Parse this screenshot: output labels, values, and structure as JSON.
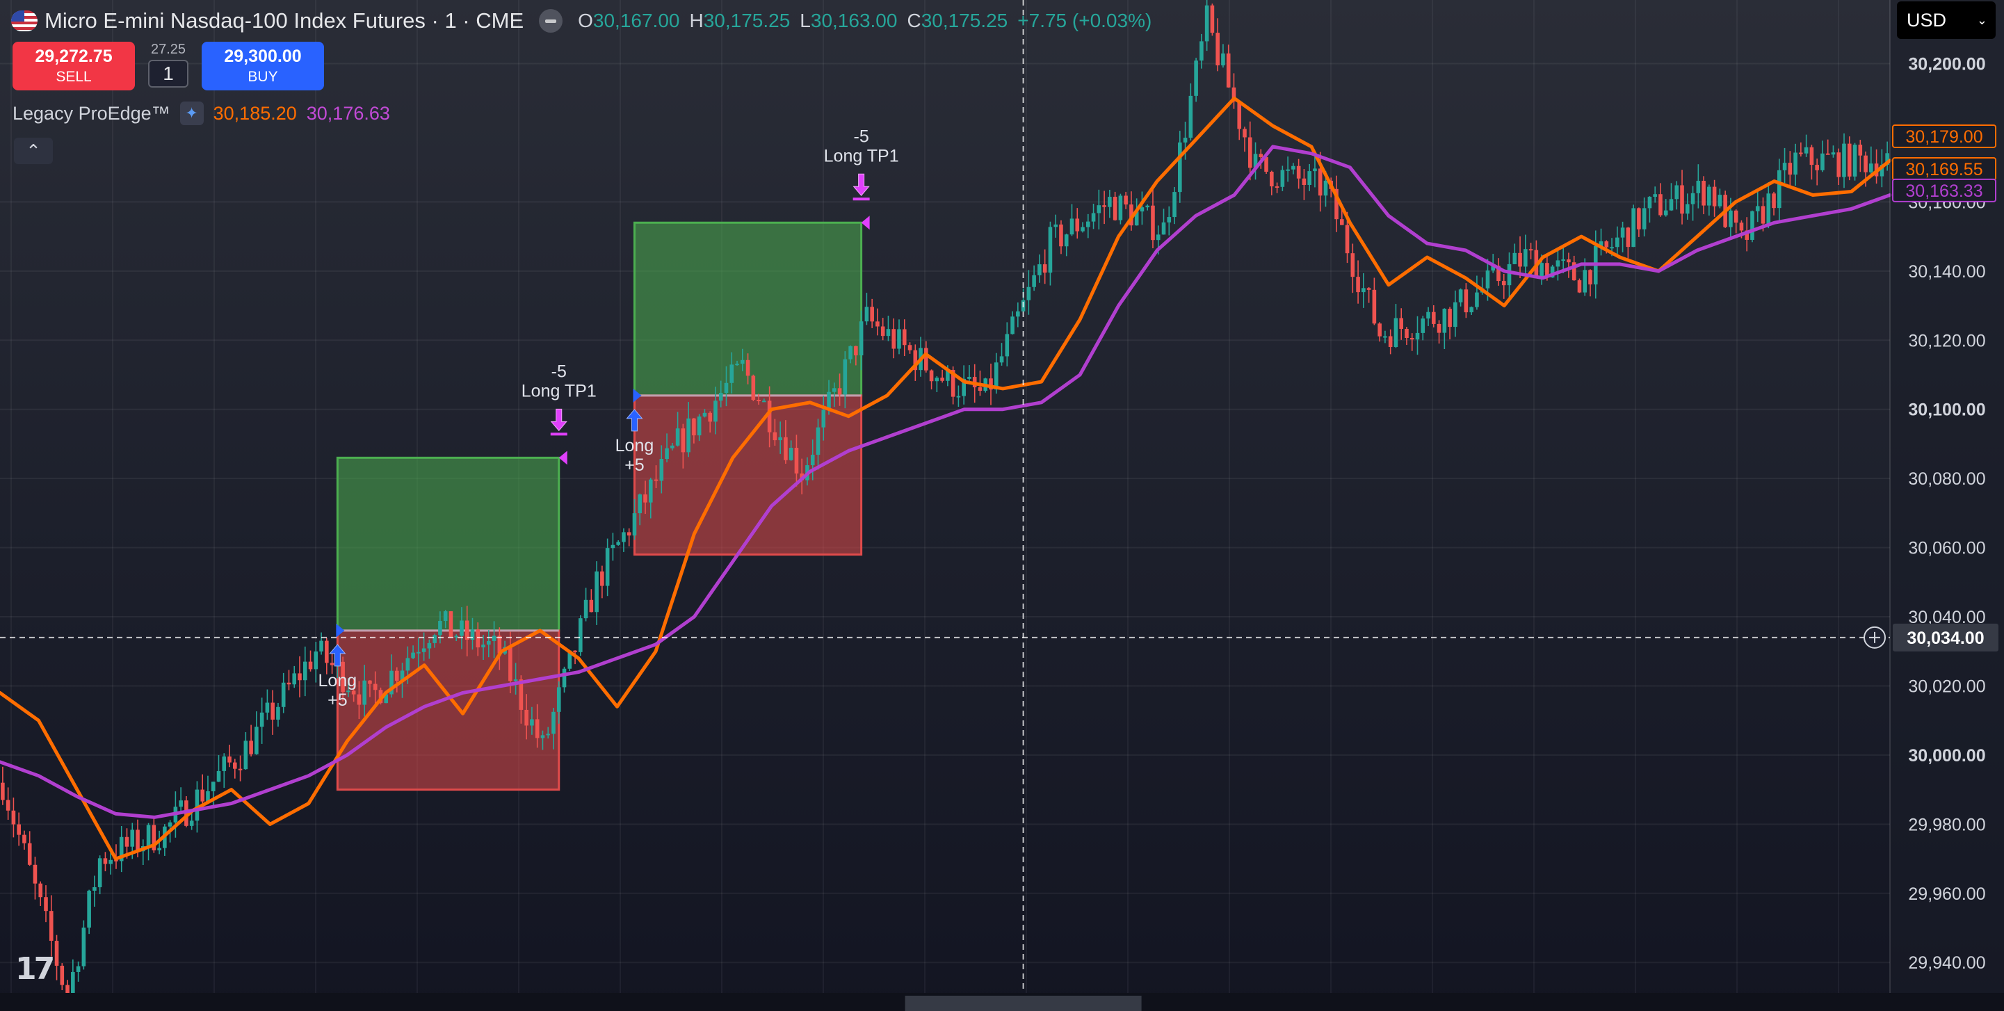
{
  "header": {
    "symbol_title": "Micro E-mini Nasdaq-100 Index Futures · 1 · CME",
    "ohlc": {
      "o_label": "O",
      "o": "30,167.00",
      "h_label": "H",
      "h": "30,175.25",
      "l_label": "L",
      "l": "30,163.00",
      "c_label": "C",
      "c": "30,175.25",
      "change": "+7.75 (+0.03%)"
    }
  },
  "order_panel": {
    "sell_price": "29,272.75",
    "sell_label": "SELL",
    "spread": "27.25",
    "quantity": "1",
    "buy_price": "29,300.00",
    "buy_label": "BUY"
  },
  "indicator": {
    "name": "Legacy ProEdge™",
    "value1": "30,185.20",
    "value2": "30,176.63"
  },
  "currency": "USD",
  "colors": {
    "up": "#26a69a",
    "down": "#ef5350",
    "fast_ma": "#ff6d00",
    "slow_ma": "#b13fcf",
    "take_profit_zone": "#4caf50",
    "stop_zone": "#e04b4b",
    "entry_arrow": "#2962ff",
    "exit_arrow": "#e040fb"
  },
  "price_axis": {
    "ticks": [
      {
        "value": 30200,
        "label": "30,200.00",
        "bold": true
      },
      {
        "value": 30160,
        "label": "30,160.00"
      },
      {
        "value": 30140,
        "label": "30,140.00"
      },
      {
        "value": 30120,
        "label": "30,120.00"
      },
      {
        "value": 30100,
        "label": "30,100.00",
        "bold": true
      },
      {
        "value": 30080,
        "label": "30,080.00"
      },
      {
        "value": 30060,
        "label": "30,060.00"
      },
      {
        "value": 30040,
        "label": "30,040.00"
      },
      {
        "value": 30020,
        "label": "30,020.00"
      },
      {
        "value": 30000,
        "label": "30,000.00",
        "bold": true
      },
      {
        "value": 29980,
        "label": "29,980.00"
      },
      {
        "value": 29960,
        "label": "29,960.00"
      },
      {
        "value": 29940,
        "label": "29,940.00"
      }
    ],
    "badges": [
      {
        "value": 30179.0,
        "label": "30,179.00",
        "color": "#ff6d00"
      },
      {
        "value": 30169.55,
        "label": "30,169.55",
        "color": "#ff6d00"
      },
      {
        "value": 30163.33,
        "label": "30,163.33",
        "color": "#b13fcf"
      }
    ],
    "crosshair": {
      "value": 30034.0,
      "label": "30,034.00"
    }
  },
  "chart_data": {
    "type": "candlestick",
    "y_range": [
      29932,
      30216
    ],
    "bar_count": 350,
    "x_range_bars": [
      0,
      350
    ],
    "segments": [
      {
        "bar": 0,
        "price": 29992
      },
      {
        "bar": 12,
        "price": 29930
      },
      {
        "bar": 18,
        "price": 29970
      },
      {
        "bar": 30,
        "price": 29978
      },
      {
        "bar": 45,
        "price": 30002
      },
      {
        "bar": 58,
        "price": 30030
      },
      {
        "bar": 68,
        "price": 30016
      },
      {
        "bar": 80,
        "price": 30038
      },
      {
        "bar": 92,
        "price": 30030
      },
      {
        "bar": 100,
        "price": 30002
      },
      {
        "bar": 110,
        "price": 30050
      },
      {
        "bar": 125,
        "price": 30090
      },
      {
        "bar": 137,
        "price": 30112
      },
      {
        "bar": 148,
        "price": 30082
      },
      {
        "bar": 160,
        "price": 30126
      },
      {
        "bar": 175,
        "price": 30108
      },
      {
        "bar": 182,
        "price": 30104
      },
      {
        "bar": 194,
        "price": 30148
      },
      {
        "bar": 205,
        "price": 30160
      },
      {
        "bar": 215,
        "price": 30152
      },
      {
        "bar": 223,
        "price": 30212
      },
      {
        "bar": 232,
        "price": 30170
      },
      {
        "bar": 245,
        "price": 30164
      },
      {
        "bar": 255,
        "price": 30122
      },
      {
        "bar": 268,
        "price": 30128
      },
      {
        "bar": 282,
        "price": 30144
      },
      {
        "bar": 292,
        "price": 30138
      },
      {
        "bar": 305,
        "price": 30158
      },
      {
        "bar": 316,
        "price": 30164
      },
      {
        "bar": 322,
        "price": 30148
      },
      {
        "bar": 332,
        "price": 30172
      }
    ],
    "series": [
      {
        "name": "fast MA",
        "color": "#ff6d00",
        "values": [
          30018,
          30010,
          29990,
          29970,
          29974,
          29984,
          29990,
          29980,
          29986,
          30004,
          30018,
          30026,
          30012,
          30030,
          30036,
          30028,
          30014,
          30030,
          30064,
          30086,
          30100,
          30102,
          30098,
          30104,
          30116,
          30108,
          30106,
          30108,
          30126,
          30150,
          30166,
          30178,
          30190,
          30182,
          30176,
          30154,
          30136,
          30144,
          30138,
          30130,
          30144,
          30150,
          30144,
          30140,
          30150,
          30160,
          30166,
          30162,
          30163,
          30172
        ]
      },
      {
        "name": "slow MA",
        "color": "#b13fcf",
        "values": [
          29998,
          29994,
          29988,
          29983,
          29982,
          29984,
          29986,
          29990,
          29994,
          30000,
          30008,
          30014,
          30018,
          30020,
          30022,
          30024,
          30028,
          30032,
          30040,
          30056,
          30072,
          30082,
          30088,
          30092,
          30096,
          30100,
          30100,
          30102,
          30110,
          30130,
          30146,
          30156,
          30162,
          30176,
          30174,
          30170,
          30156,
          30148,
          30146,
          30140,
          30138,
          30142,
          30142,
          30140,
          30146,
          30150,
          30154,
          30156,
          30158,
          30162
        ]
      }
    ],
    "trade_boxes": [
      {
        "start_bar": 62,
        "end_bar": 103,
        "entry": 30036,
        "target": 30086,
        "stop": 29990
      },
      {
        "start_bar": 117,
        "end_bar": 159,
        "entry": 30104,
        "target": 30154,
        "stop": 30058
      }
    ],
    "annotations": [
      {
        "text": "Long\n+5",
        "bar": 62,
        "price": 30036,
        "type": "entry"
      },
      {
        "text": "-5\nLong TP1",
        "bar": 103,
        "price": 30086,
        "type": "exit"
      },
      {
        "text": "Long\n+5",
        "bar": 117,
        "price": 30104,
        "type": "entry"
      },
      {
        "text": "-5\nLong TP1",
        "bar": 159,
        "price": 30154,
        "type": "exit"
      }
    ],
    "crosshair": {
      "bar": 189,
      "price": 30034.0
    }
  }
}
